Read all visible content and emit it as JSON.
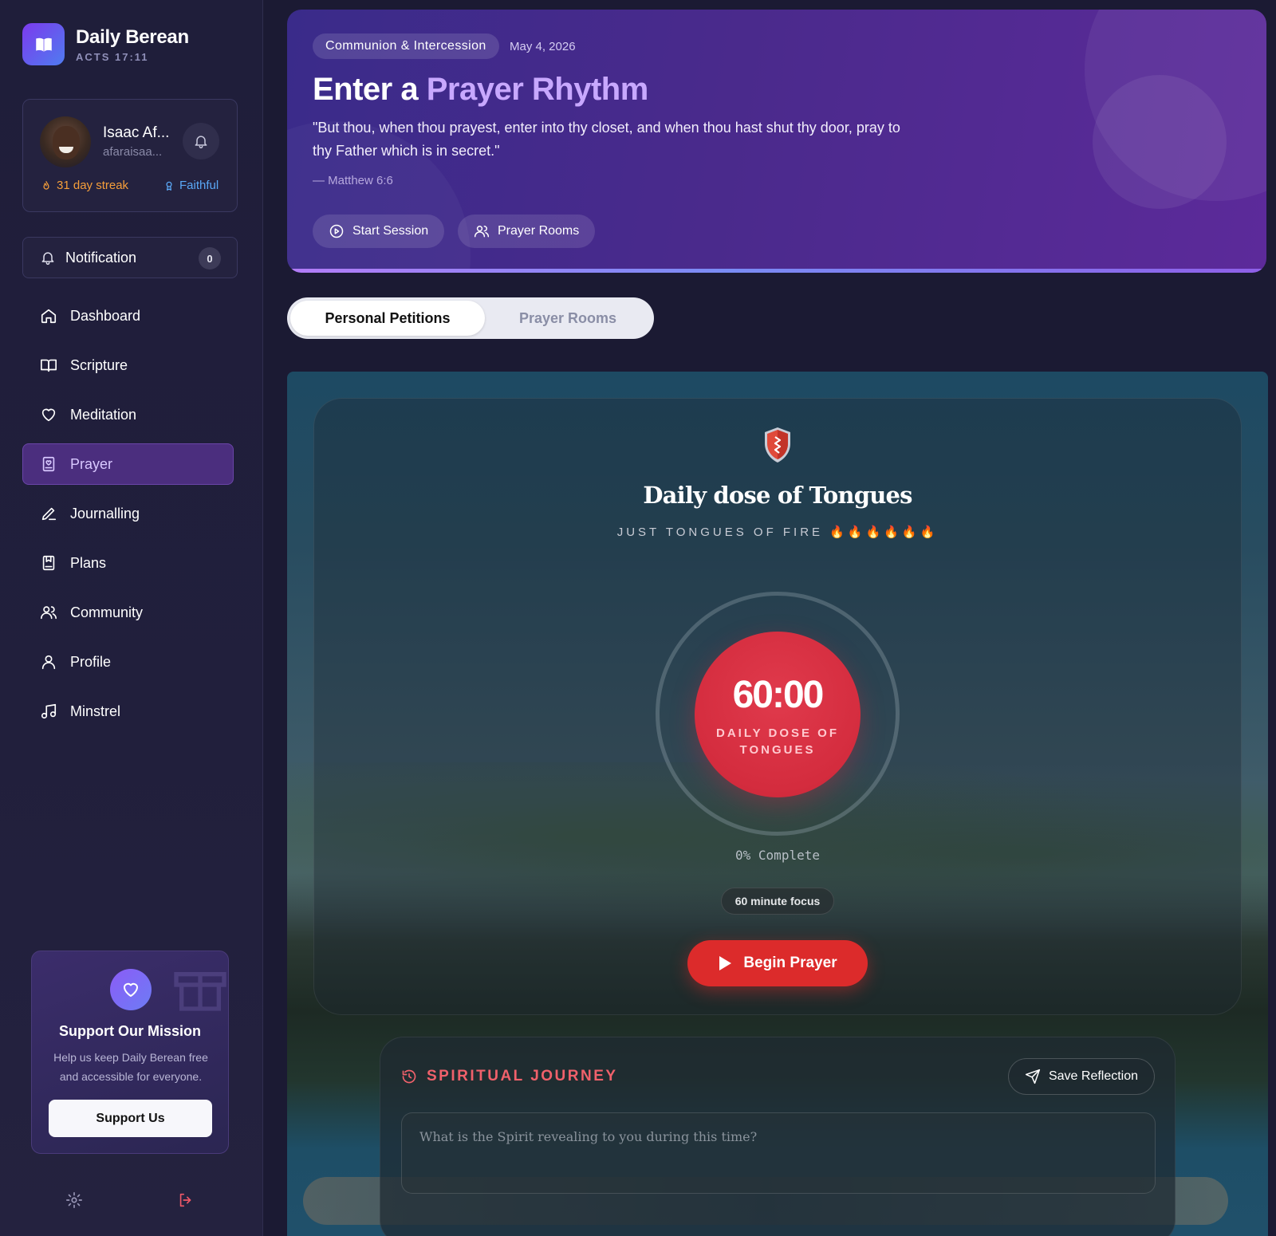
{
  "brand": {
    "title": "Daily Berean",
    "subtitle": "ACTS 17:11"
  },
  "user": {
    "name": "Isaac Af...",
    "handle": "afaraisaa...",
    "streak": "31 day streak",
    "badge": "Faithful"
  },
  "notification": {
    "label": "Notification",
    "count": "0"
  },
  "nav": {
    "items": [
      {
        "label": "Dashboard",
        "icon": "home-icon"
      },
      {
        "label": "Scripture",
        "icon": "book-open-icon"
      },
      {
        "label": "Meditation",
        "icon": "heart-icon"
      },
      {
        "label": "Prayer",
        "icon": "prayer-book-icon",
        "active": true
      },
      {
        "label": "Journalling",
        "icon": "pen-icon"
      },
      {
        "label": "Plans",
        "icon": "bookmark-book-icon"
      },
      {
        "label": "Community",
        "icon": "users-icon"
      },
      {
        "label": "Profile",
        "icon": "user-icon"
      },
      {
        "label": "Minstrel",
        "icon": "music-icon"
      }
    ]
  },
  "support": {
    "title": "Support Our Mission",
    "description": "Help us keep Daily Berean free and accessible for everyone.",
    "button": "Support Us"
  },
  "hero": {
    "category": "Communion & Intercession",
    "date": "May 4, 2026",
    "title_prefix": "Enter a",
    "title_accent": "Prayer Rhythm",
    "quote": "\"But thou, when thou prayest, enter into thy closet, and when thou hast shut thy door, pray to thy Father which is in secret.\"",
    "reference": "— Matthew 6:6",
    "start_button": "Start Session",
    "rooms_button": "Prayer Rooms"
  },
  "tabs": {
    "personal": "Personal Petitions",
    "rooms": "Prayer Rooms"
  },
  "session": {
    "title": "Daily dose of Tongues",
    "subtitle": "JUST TONGUES OF FIRE 🔥🔥🔥🔥🔥🔥",
    "timer": "60:00",
    "timer_label": "DAILY DOSE OF TONGUES",
    "progress_text": "0% Complete",
    "progress_value": 0,
    "focus": "60 minute focus",
    "begin_button": "Begin Prayer"
  },
  "journal": {
    "heading": "SPIRITUAL JOURNEY",
    "save_button": "Save Reflection",
    "placeholder": "What is the Spirit revealing to you during this time?"
  },
  "colors": {
    "accent_purple": "#c8a8ff",
    "timer_red": "#d42c3e",
    "begin_red": "#dc2b2b",
    "streak_orange": "#f59e3a",
    "faithful_blue": "#5aa8f6",
    "journal_red": "#f0616b"
  }
}
